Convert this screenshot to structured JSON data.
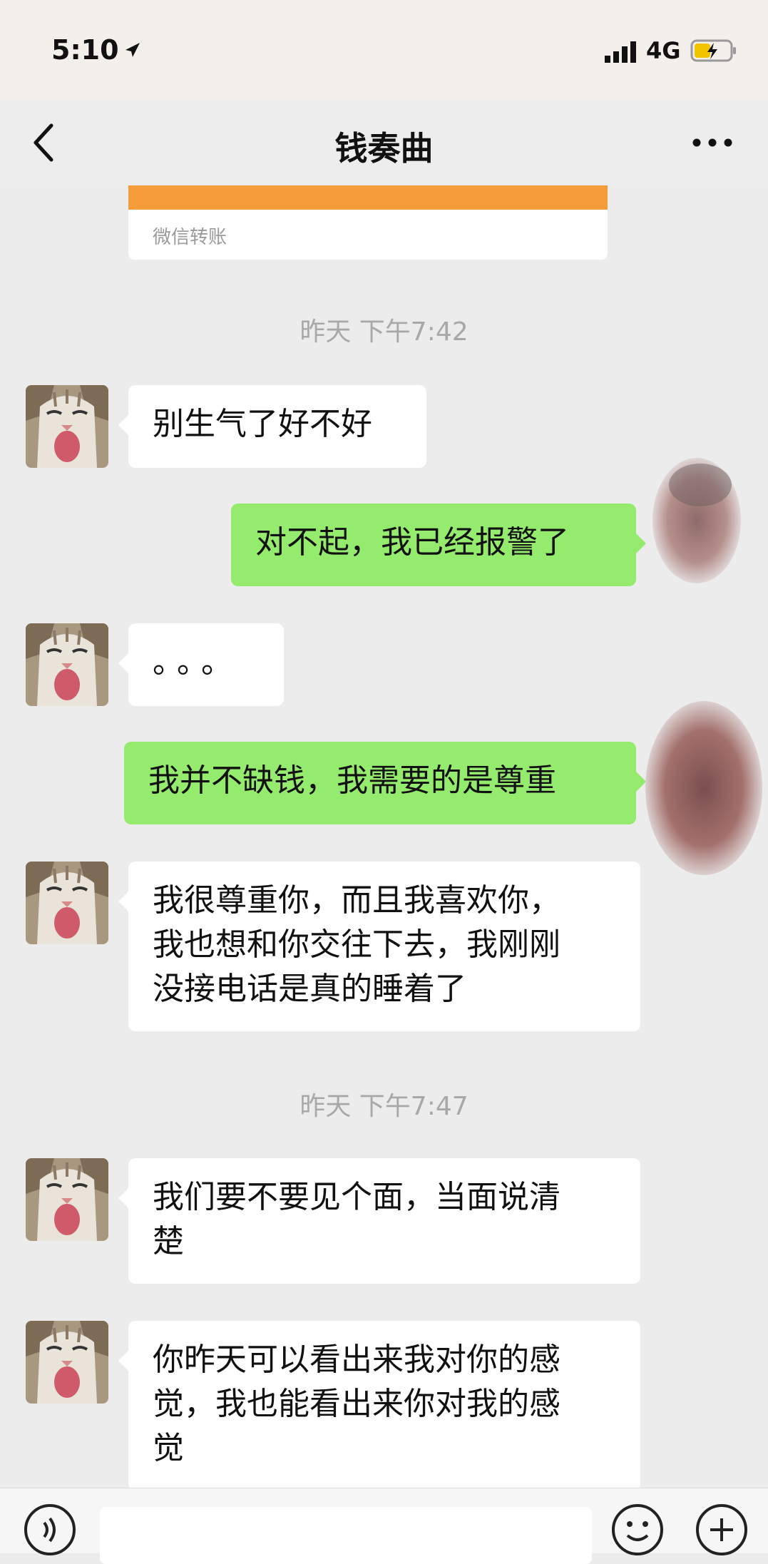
{
  "status_bar": {
    "time": "5:10",
    "network": "4G"
  },
  "header": {
    "title": "钱奏曲"
  },
  "transfer": {
    "label": "微信转账"
  },
  "timestamps": [
    "昨天 下午7:42",
    "昨天 下午7:47"
  ],
  "messages": [
    {
      "side": "left",
      "text": "别生气了好不好"
    },
    {
      "side": "right",
      "text": "对不起，我已经报警了"
    },
    {
      "side": "left",
      "text": "。。。"
    },
    {
      "side": "right",
      "text": "我并不缺钱，我需要的是尊重"
    },
    {
      "side": "left",
      "text": "我很尊重你，而且我喜欢你，\n我也想和你交往下去，我刚刚\n没接电话是真的睡着了"
    },
    {
      "side": "left",
      "text": "我们要不要见个面，当面说清\n楚"
    },
    {
      "side": "left",
      "text": "你昨天可以看出来我对你的感\n觉，我也能看出来你对我的感\n觉"
    }
  ],
  "input": {
    "value": ""
  },
  "colors": {
    "sent_bubble": "#95eb6d",
    "received_bubble": "#ffffff",
    "transfer_orange": "#f59c3b",
    "background": "#ececec"
  }
}
